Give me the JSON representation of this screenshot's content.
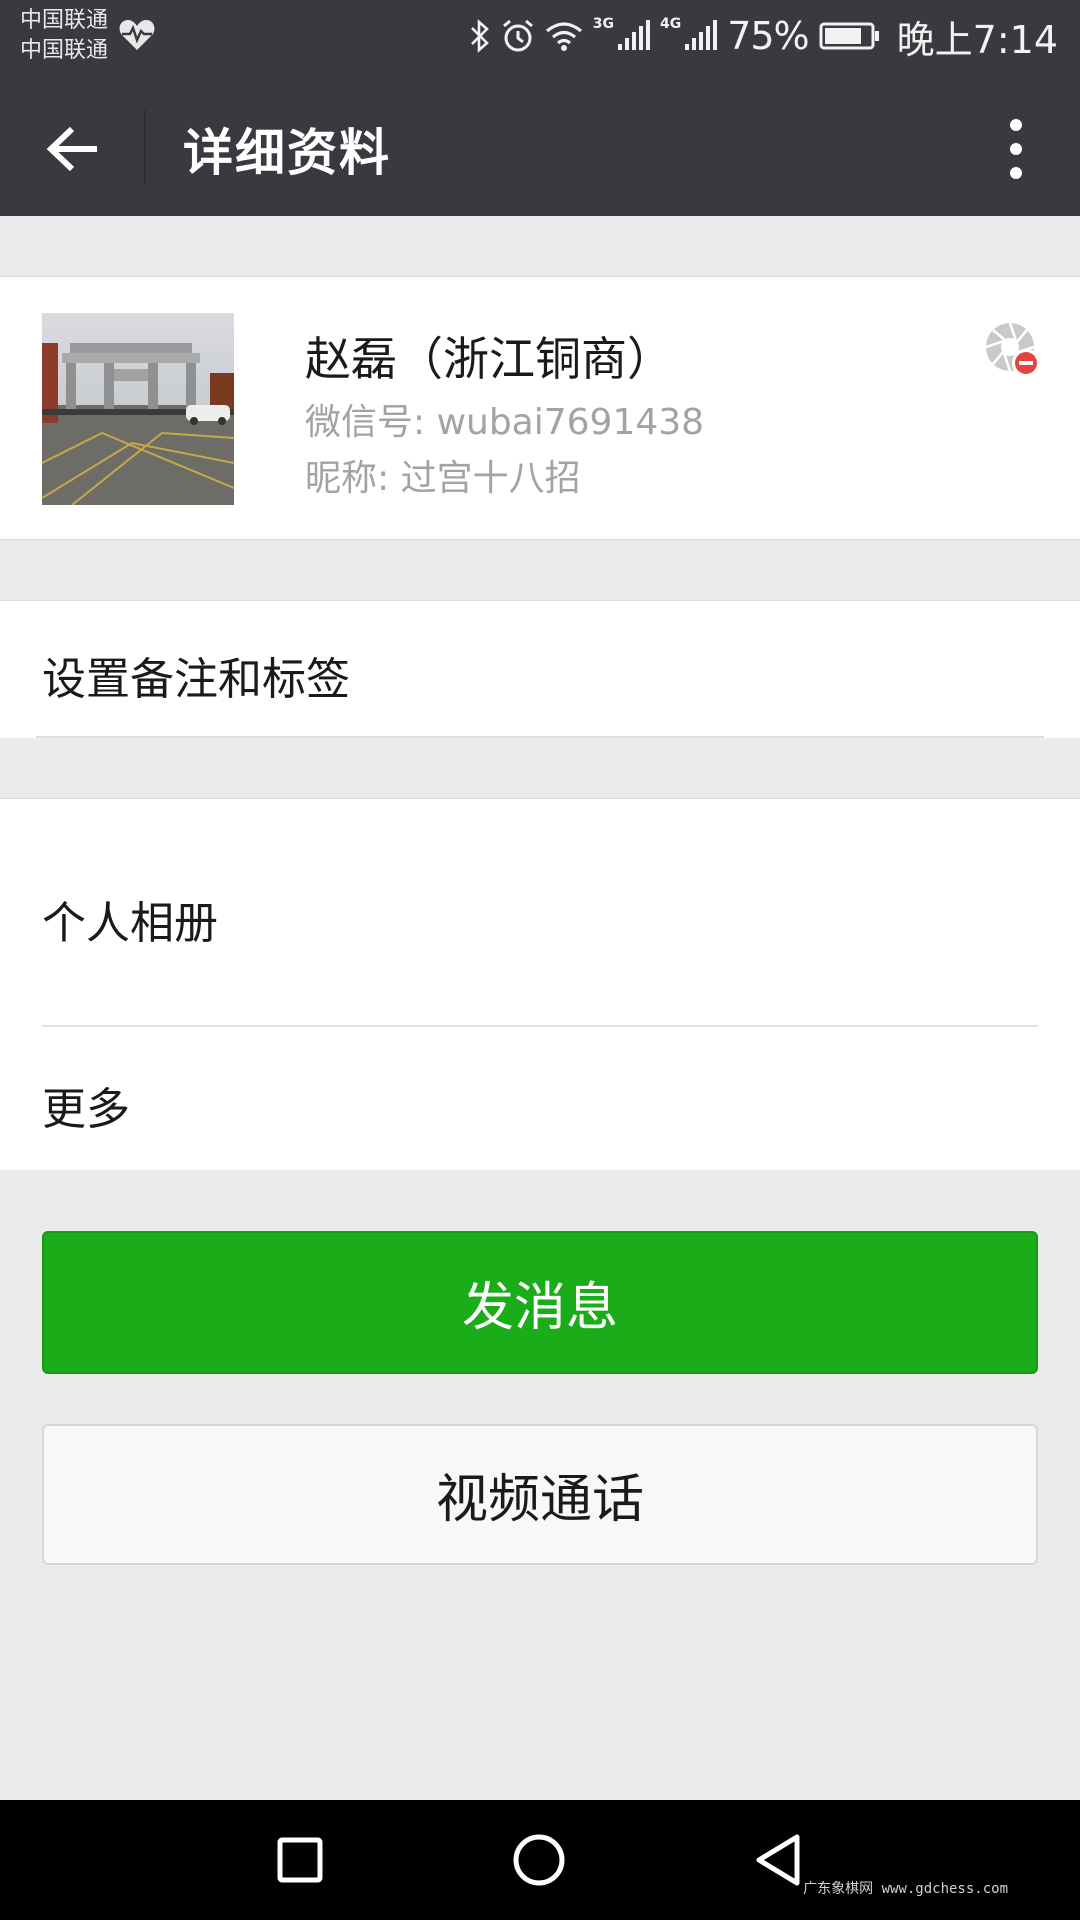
{
  "status_bar": {
    "carrier_1": "中国联通",
    "carrier_2": "中国联通",
    "network_tag_1": "3G",
    "network_tag_2": "4G",
    "battery_percent": "75%",
    "time": "晚上7:14"
  },
  "header": {
    "title": "详细资料"
  },
  "profile": {
    "name": "赵磊（浙江铜商）",
    "wechat_id_line": "微信号: wubai7691438",
    "nickname_line": "昵称: 过宫十八招"
  },
  "rows": {
    "remark_tags": "设置备注和标签",
    "personal_album": "个人相册",
    "more": "更多"
  },
  "buttons": {
    "send_message": "发消息",
    "video_call": "视频通话"
  },
  "watermark": "广东象棋网 www.gdchess.com",
  "colors": {
    "header_bg": "#393a3f",
    "page_bg": "#ebebeb",
    "primary_green": "#1aad19",
    "secondary_text": "#a3a3a3",
    "badge_red": "#e64340"
  },
  "icons": {
    "back": "arrow-left-icon",
    "overflow": "more-vertical-icon",
    "moments": "album-shutter-icon",
    "health": "heart-pulse-icon"
  }
}
